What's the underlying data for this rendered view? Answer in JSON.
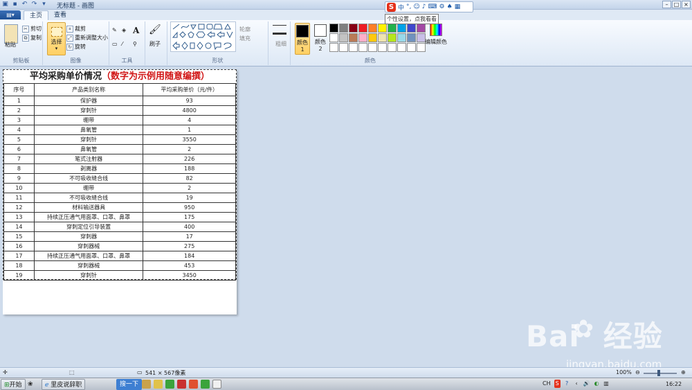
{
  "window": {
    "title": "无标题 - 画图"
  },
  "tabs": [
    {
      "label": "主页",
      "active": true
    },
    {
      "label": "查看",
      "active": false
    }
  ],
  "ribbon": {
    "clipboard": {
      "label": "剪贴板",
      "paste": "粘贴",
      "cut": "剪切",
      "copy": "复制"
    },
    "image": {
      "label": "图像",
      "select": "选择",
      "crop": "裁剪",
      "resize": "重新调整大小",
      "rotate": "旋转"
    },
    "tools": {
      "label": "工具"
    },
    "brushes": {
      "label": "刷子"
    },
    "shapes": {
      "label": "形状",
      "outline": "轮廓",
      "fill": "填充"
    },
    "size": {
      "label": "粗细"
    },
    "colors": {
      "label": "颜色",
      "color1": "颜色 1",
      "color2": "颜色 2",
      "edit": "编辑颜色",
      "color1_value": "#000000",
      "color2_value": "#ffffff",
      "palette": [
        "#000000",
        "#7f7f7f",
        "#880015",
        "#ed1c24",
        "#ff7f27",
        "#fff200",
        "#22b14c",
        "#00a2e8",
        "#3f48cc",
        "#a349a4",
        "",
        "#ffffff",
        "#c3c3c3",
        "#b97a57",
        "#ffaec9",
        "#ffc90e",
        "#efe4b0",
        "#b5e61d",
        "#99d9ea",
        "#7092be",
        "#c8bfe7",
        "",
        "#ffffff",
        "#ffffff",
        "#ffffff",
        "#ffffff",
        "#ffffff",
        "#ffffff",
        "#ffffff",
        "#ffffff",
        "#ffffff",
        "#ffffff",
        ""
      ]
    }
  },
  "ime": {
    "logo": "S",
    "mode": "中",
    "tooltip": "个性设置，点我看看"
  },
  "sheet": {
    "title_black": "平均采购单价情况",
    "title_red": "（数字为示例用随意编撰）",
    "headers": [
      "序号",
      "产品类别名称",
      "平均采购单价（元/件）"
    ],
    "rows": [
      [
        "1",
        "保护器",
        "93"
      ],
      [
        "2",
        "穿刺针",
        "4800"
      ],
      [
        "3",
        "绷带",
        "4"
      ],
      [
        "4",
        "鼻氧管",
        "1"
      ],
      [
        "5",
        "穿刺针",
        "3550"
      ],
      [
        "6",
        "鼻氧管",
        "2"
      ],
      [
        "7",
        "笔式注射器",
        "226"
      ],
      [
        "8",
        "剥离器",
        "188"
      ],
      [
        "9",
        "不可吸收缝合线",
        "82"
      ],
      [
        "10",
        "绷带",
        "2"
      ],
      [
        "11",
        "不可吸收缝合线",
        "19"
      ],
      [
        "12",
        "材料输送器具",
        "950"
      ],
      [
        "13",
        "持续正压通气用面罩、口罩、鼻罩",
        "175"
      ],
      [
        "14",
        "穿刺定位引导装置",
        "400"
      ],
      [
        "15",
        "穿刺器",
        "17"
      ],
      [
        "16",
        "穿刺器械",
        "275"
      ],
      [
        "17",
        "持续正压通气用面罩、口罩、鼻罩",
        "184"
      ],
      [
        "18",
        "穿刺器械",
        "453"
      ],
      [
        "19",
        "穿刺针",
        "3450"
      ]
    ]
  },
  "status": {
    "dimensions": "541 × 567像素",
    "zoom": "100%"
  },
  "watermark": {
    "brand": "Bai",
    "brand2": "经验",
    "url": "jingyan.baidu.com"
  },
  "taskbar": {
    "start": "开始",
    "browser": "里皮说辞职",
    "search": "搜一下",
    "lang": "CH",
    "clock": "16:22"
  }
}
